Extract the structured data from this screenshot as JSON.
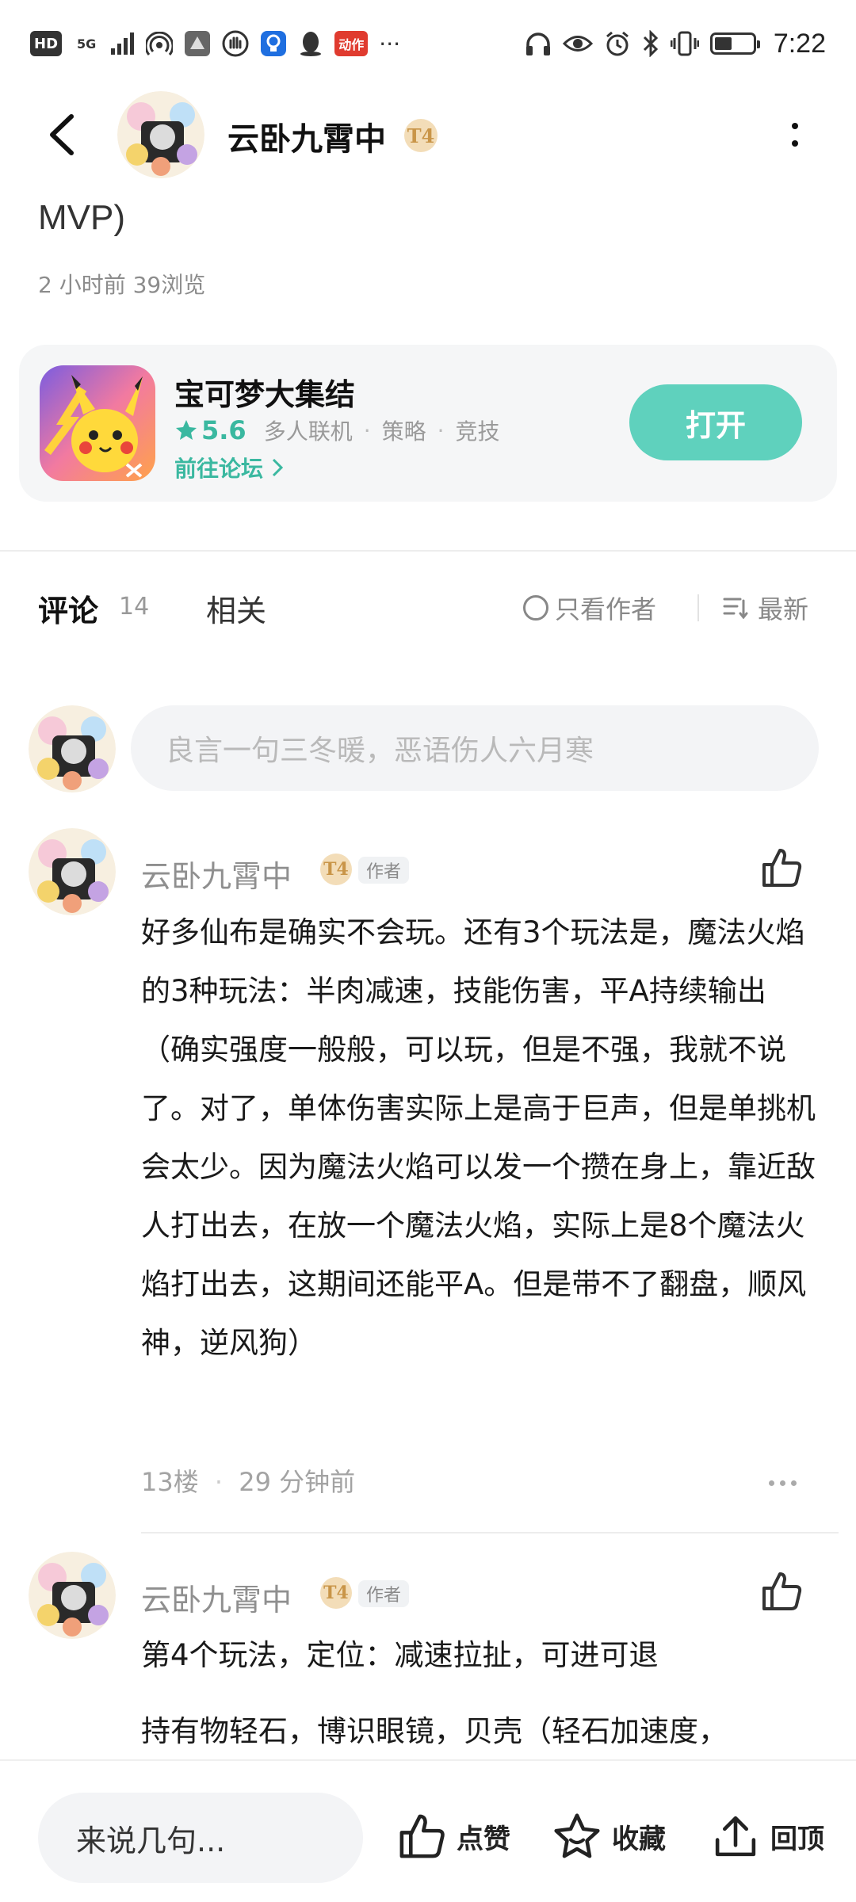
{
  "status_bar": {
    "left_chips": [
      "HD",
      "5G"
    ],
    "app_badge": "动作",
    "more": "···",
    "time": "7:22",
    "battery_level": 0.45
  },
  "nav": {
    "title": "云卧九霄中",
    "level_badge": "T4"
  },
  "post": {
    "content_tail": "MVP)",
    "meta": "2 小时前  39浏览"
  },
  "game_card": {
    "name": "宝可梦大集结",
    "rating": "5.6",
    "tags": [
      "多人联机",
      "策略",
      "竞技"
    ],
    "forum_link": "前往论坛",
    "open_button": "打开",
    "accent_color": "#5fd1bd"
  },
  "tabs": {
    "comments_label": "评论",
    "comments_count": "14",
    "related_label": "相关",
    "author_only": "只看作者",
    "sort_label": "最新"
  },
  "comment_input": {
    "placeholder": "良言一句三冬暖，恶语伤人六月寒"
  },
  "comments": [
    {
      "author": "云卧九霄中",
      "level_badge": "T4",
      "author_tag": "作者",
      "text": "好多仙布是确实不会玩。还有3个玩法是，魔法火焰的3种玩法：半肉减速，技能伤害，平A持续输出（确实强度一般般，可以玩，但是不强，我就不说了。对了，单体伤害实际上是高于巨声，但是单挑机会太少。因为魔法火焰可以发一个攒在身上，靠近敌人打出去，在放一个魔法火焰，实际上是8个魔法火焰打出去，这期间还能平A。但是带不了翻盘，顺风神，逆风狗）",
      "floor": "13楼",
      "time": "29 分钟前"
    },
    {
      "author": "云卧九霄中",
      "level_badge": "T4",
      "author_tag": "作者",
      "text_line1": "第4个玩法，定位：减速拉扯，可进可退",
      "text_line2": "持有物轻石，博识眼镜，贝壳（轻石加速度，"
    }
  ],
  "bottom_bar": {
    "input_placeholder": "来说几句...",
    "like_label": "点赞",
    "favorite_label": "收藏",
    "top_label": "回顶"
  }
}
